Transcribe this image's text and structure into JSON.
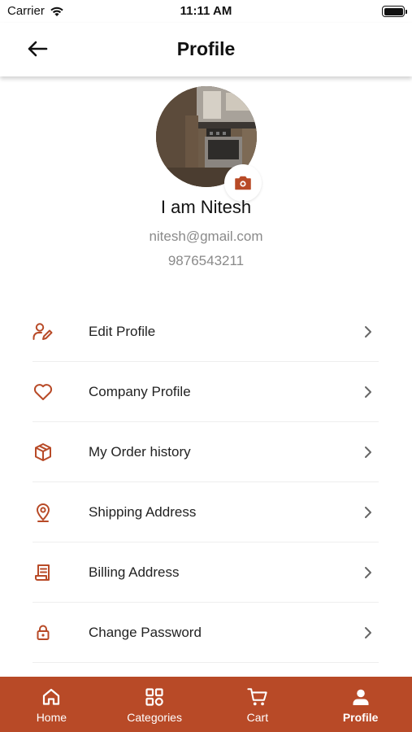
{
  "status_bar": {
    "carrier": "Carrier",
    "time": "11:11 AM"
  },
  "header": {
    "title": "Profile"
  },
  "profile": {
    "name": "I am Nitesh",
    "email": "nitesh@gmail.com",
    "phone": "9876543211"
  },
  "menu": {
    "items": [
      {
        "label": "Edit Profile",
        "icon": "edit-user-icon"
      },
      {
        "label": "Company Profile",
        "icon": "heart-icon"
      },
      {
        "label": "My Order history",
        "icon": "package-icon"
      },
      {
        "label": "Shipping Address",
        "icon": "location-pin-icon"
      },
      {
        "label": "Billing Address",
        "icon": "receipt-icon"
      },
      {
        "label": "Change Password",
        "icon": "lock-icon"
      }
    ]
  },
  "bottom_nav": {
    "items": [
      {
        "label": "Home",
        "icon": "home-icon"
      },
      {
        "label": "Categories",
        "icon": "grid-icon"
      },
      {
        "label": "Cart",
        "icon": "cart-icon"
      },
      {
        "label": "Profile",
        "icon": "user-icon"
      }
    ],
    "active": "Profile"
  },
  "colors": {
    "accent": "#b84a27",
    "text_primary": "#111111",
    "text_secondary": "#8a8a8a",
    "divider": "#eeeeee"
  }
}
